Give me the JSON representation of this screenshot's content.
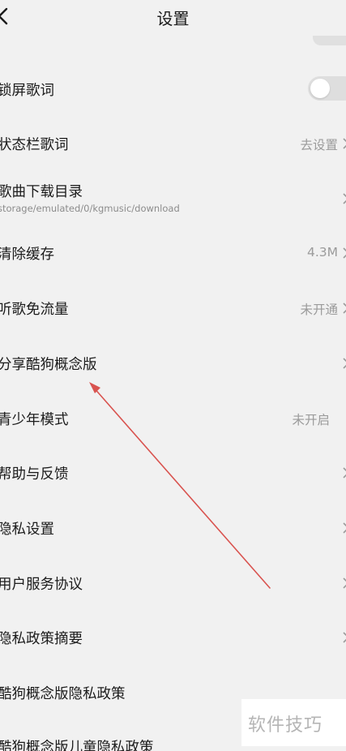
{
  "header": {
    "title": "设置",
    "back_icon": "chevron-left-icon"
  },
  "settings": [
    {
      "label": "锁屏歌词",
      "control": "toggle",
      "toggle_on": false
    },
    {
      "label": "状态栏歌词",
      "value": "去设置"
    },
    {
      "label": "歌曲下载目录",
      "sublabel": "storage/emulated/0/kgmusic/download"
    },
    {
      "label": "清除缓存",
      "value": "4.3M"
    },
    {
      "label": "听歌免流量",
      "value": "未开通"
    },
    {
      "label": "分享酷狗概念版",
      "value": ""
    },
    {
      "label": "青少年模式",
      "value": "未开启"
    },
    {
      "label": "帮助与反馈"
    },
    {
      "label": "隐私设置"
    },
    {
      "label": "用户服务协议"
    },
    {
      "label": "隐私政策摘要"
    },
    {
      "label": "酷狗概念版隐私政策"
    },
    {
      "label": "酷狗概念版儿童隐私政策"
    }
  ],
  "annotation": {
    "arrow_color": "#d9534f",
    "points_to": "分享酷狗概念版"
  },
  "watermark": {
    "text": "软件技巧"
  },
  "colors": {
    "background": "#f1f1f1",
    "text": "#1b1b1b",
    "secondary": "#9b9b9b",
    "toggle_off": "#dedede"
  }
}
